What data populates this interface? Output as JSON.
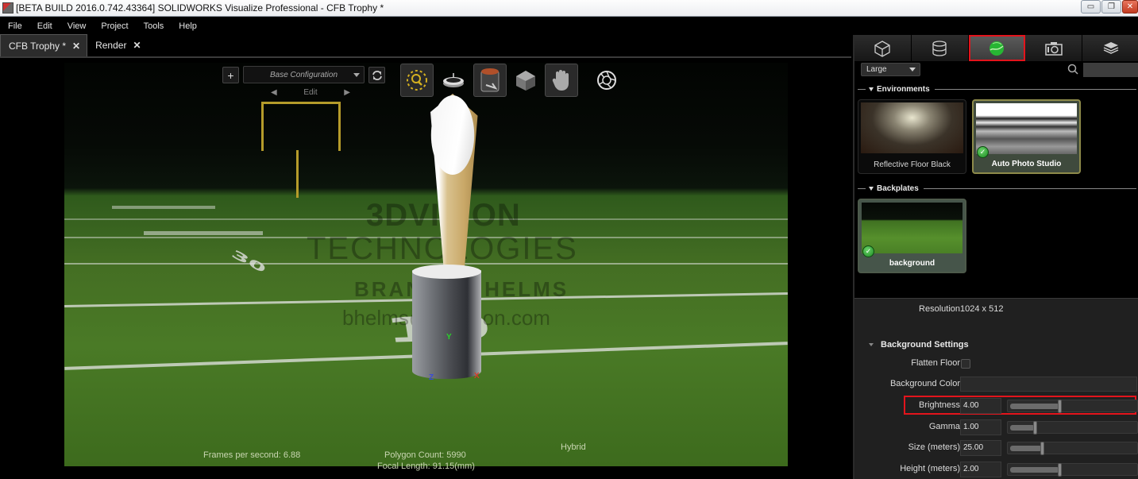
{
  "window": {
    "title": "[BETA BUILD 2016.0.742.43364] SOLIDWORKS Visualize Professional - CFB Trophy *",
    "controls": {
      "minimize": "▭",
      "restore": "❐",
      "close": "✕"
    }
  },
  "menu": [
    "File",
    "Edit",
    "View",
    "Project",
    "Tools",
    "Help"
  ],
  "tabs": [
    {
      "label": "CFB Trophy *",
      "close": "✕",
      "active": true
    },
    {
      "label": "Render",
      "close": "✕",
      "active": false
    }
  ],
  "viewport": {
    "add_button": "+",
    "configuration": "Base Configuration",
    "edit_label": "Edit",
    "tools": [
      "zoom-tool",
      "turntable-tool",
      "object-tool",
      "camera-3d-tool",
      "pan-tool",
      "aperture-tool"
    ],
    "watermark": {
      "line1": "3DVISION",
      "line2": "TECHNOLOGIES",
      "line3": "BRANDON HELMS",
      "line4": "bhelms@3dvision.com"
    },
    "axes": {
      "x": "X",
      "y": "Y",
      "z": "Z"
    },
    "field_numbers": [
      "30",
      "10"
    ],
    "stats": {
      "fps": "Frames per second: 6.88",
      "polygons": "Polygon Count: 5990",
      "focal_length": "Focal Length: 91.15(mm)",
      "render_mode": "Hybrid"
    }
  },
  "panel": {
    "tabs": [
      "models-tab",
      "appearances-tab",
      "scenes-tab",
      "cameras-tab",
      "libraries-tab"
    ],
    "active_tab": 2,
    "thumb_size": "Large",
    "search_placeholder": "",
    "environments_label": "Environments",
    "environments": [
      {
        "name": "Reflective Floor Black",
        "selected": false
      },
      {
        "name": "Auto Photo Studio",
        "selected": true
      }
    ],
    "backplates_label": "Backplates",
    "backplates": [
      {
        "name": "background",
        "selected": true
      }
    ],
    "properties": {
      "resolution_label": "Resolution",
      "resolution_value": "1024 x 512",
      "section_label": "Background Settings",
      "flatten_floor_label": "Flatten Floor",
      "flatten_floor_checked": false,
      "background_color_label": "Background Color",
      "brightness_label": "Brightness",
      "brightness_value": "4.00",
      "brightness_slider": 0.4,
      "gamma_label": "Gamma",
      "gamma_value": "1.00",
      "gamma_slider": 0.2,
      "size_label": "Size (meters)",
      "size_value": "25.00",
      "size_slider": 0.26,
      "height_label": "Height (meters)",
      "height_value": "2.00",
      "height_slider": 0.4
    }
  },
  "colors": {
    "highlight": "#e3141c",
    "selected_env": "#3f4a3d",
    "check_green": "#1c8a22",
    "accent_gold": "#b59b2a"
  }
}
